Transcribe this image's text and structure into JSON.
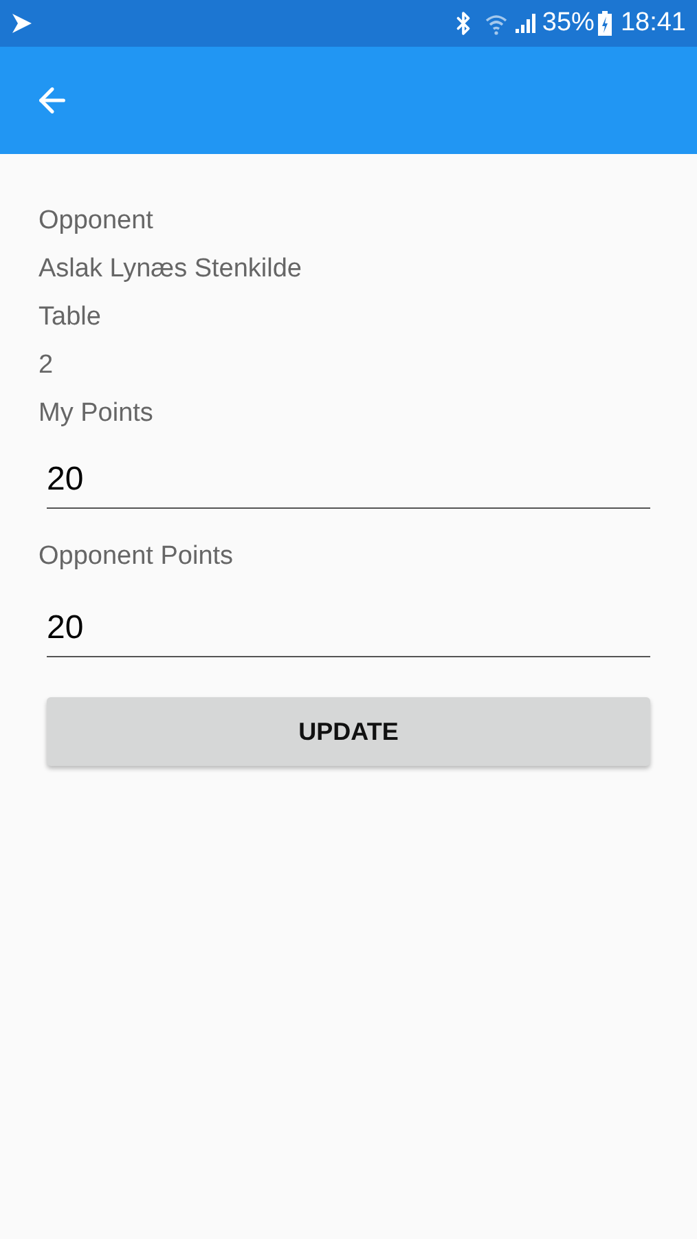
{
  "status_bar": {
    "battery_percent": "35%",
    "time": "18:41"
  },
  "details": [
    "Opponent",
    "Aslak Lynæs Stenkilde",
    "Table",
    "2",
    "My Points"
  ],
  "my_points": {
    "value": "20"
  },
  "opponent_points": {
    "label": "Opponent Points",
    "value": "20"
  },
  "update_button": {
    "label": "UPDATE"
  }
}
